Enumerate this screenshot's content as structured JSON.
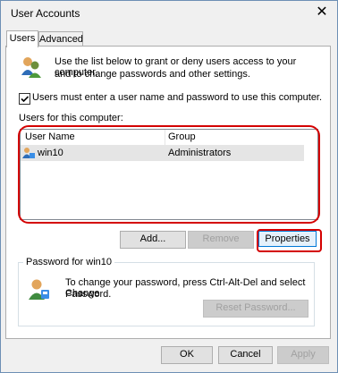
{
  "window": {
    "title": "User Accounts"
  },
  "tabs": [
    {
      "label": "Users",
      "active": true
    },
    {
      "label": "Advanced",
      "active": false
    }
  ],
  "intro": {
    "line1": "Use the list below to grant or deny users access to your computer,",
    "line2": "and to change passwords and other settings."
  },
  "checkbox": {
    "label": "Users must enter a user name and password to use this computer.",
    "checked": true
  },
  "users_section": {
    "label": "Users for this computer:"
  },
  "table": {
    "headers": [
      "User Name",
      "Group"
    ],
    "rows": [
      {
        "user": "win10",
        "group": "Administrators",
        "selected": true
      }
    ]
  },
  "buttons": {
    "add": "Add...",
    "remove": "Remove",
    "properties": "Properties"
  },
  "password_group": {
    "title": "Password for win10",
    "text1": "To change your password, press Ctrl-Alt-Del and select Change",
    "text2": "Password.",
    "reset": "Reset Password..."
  },
  "footer": {
    "ok": "OK",
    "cancel": "Cancel",
    "apply": "Apply"
  },
  "colors": {
    "accent": "#0078d7",
    "highlight_red": "#d40000",
    "selected_row": "#e5e5e5"
  }
}
